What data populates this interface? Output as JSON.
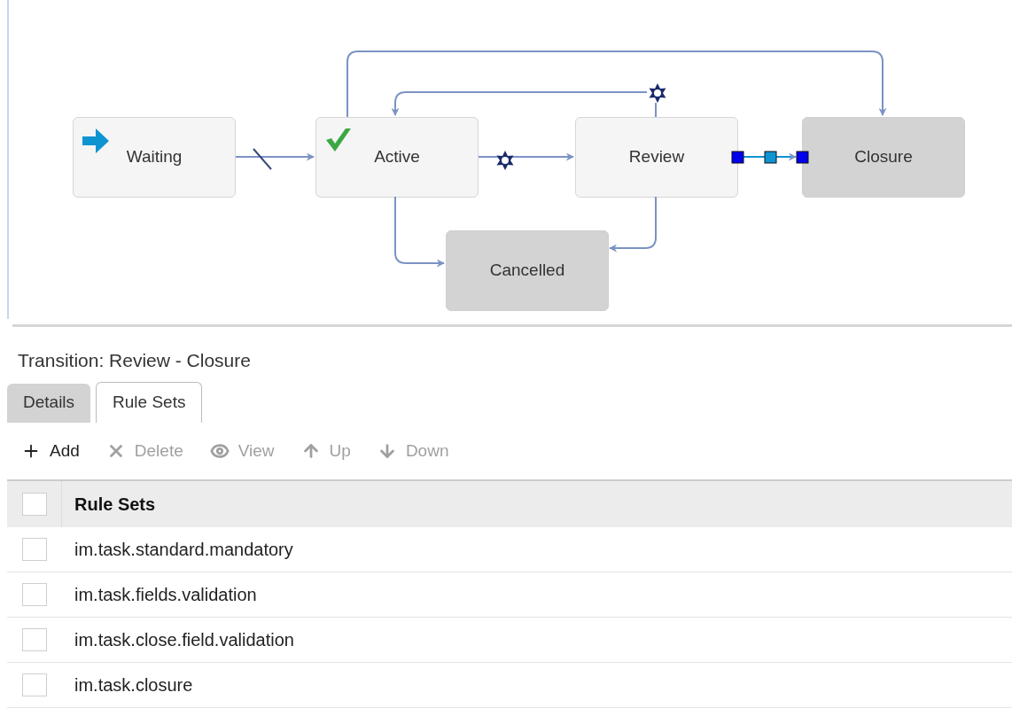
{
  "diagram": {
    "states": [
      {
        "name": "Waiting",
        "kind": "initial"
      },
      {
        "name": "Active",
        "kind": "current"
      },
      {
        "name": "Review",
        "kind": "normal"
      },
      {
        "name": "Closure",
        "kind": "closed"
      },
      {
        "name": "Cancelled",
        "kind": "closed"
      }
    ]
  },
  "panel": {
    "title": "Transition: Review - Closure",
    "tabs": [
      {
        "label": "Details",
        "selected": false
      },
      {
        "label": "Rule Sets",
        "selected": true
      }
    ],
    "toolbar": [
      {
        "label": "Add",
        "disabled": false
      },
      {
        "label": "Delete",
        "disabled": true
      },
      {
        "label": "View",
        "disabled": true
      },
      {
        "label": "Up",
        "disabled": true
      },
      {
        "label": "Down",
        "disabled": true
      }
    ],
    "table": {
      "header": {
        "label": "Rule Sets",
        "checked": false
      },
      "rows": [
        {
          "name": "im.task.standard.mandatory",
          "checked": false
        },
        {
          "name": "im.task.fields.validation",
          "checked": false
        },
        {
          "name": "im.task.close.field.validation",
          "checked": false
        },
        {
          "name": "im.task.closure",
          "checked": false
        }
      ]
    }
  }
}
